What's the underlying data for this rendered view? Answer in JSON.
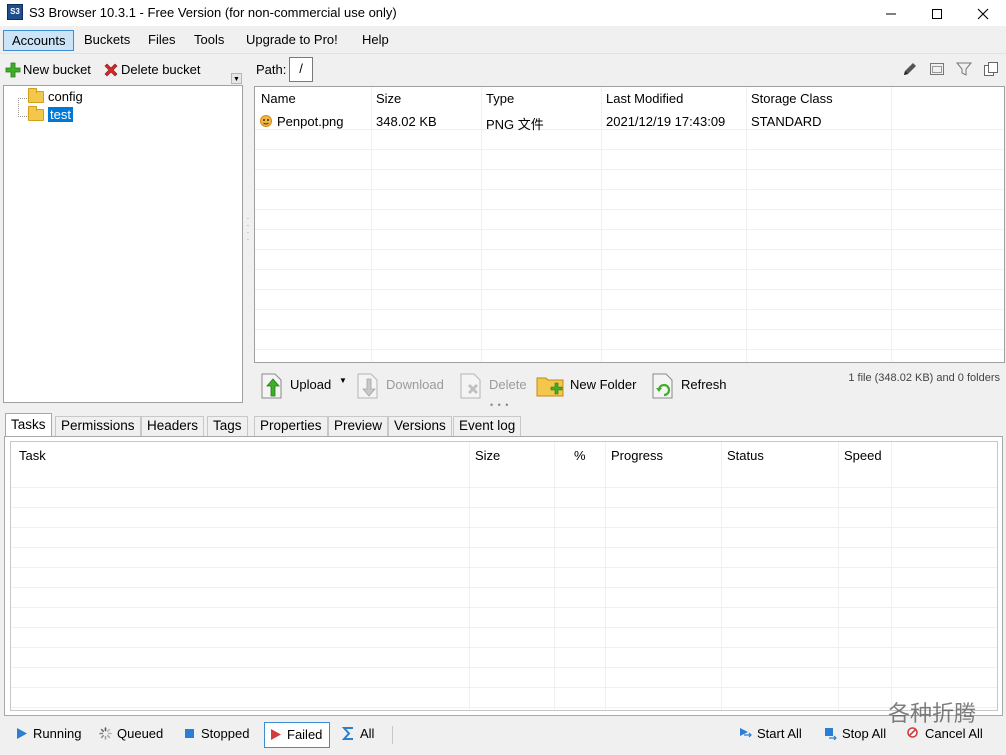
{
  "window": {
    "title": "S3 Browser 10.3.1 - Free Version (for non-commercial use only)",
    "icon_label": "S3"
  },
  "menu": [
    "Accounts",
    "Buckets",
    "Files",
    "Tools",
    "Upgrade to Pro!",
    "Help"
  ],
  "left_toolbar": {
    "new_bucket": "New bucket",
    "delete_bucket": "Delete bucket"
  },
  "tree": {
    "items": [
      "config",
      "test"
    ],
    "selected": "test"
  },
  "path": {
    "label": "Path:",
    "value": "/"
  },
  "file_table": {
    "columns": [
      "Name",
      "Size",
      "Type",
      "Last Modified",
      "Storage Class"
    ],
    "rows": [
      [
        "Penpot.png",
        "348.02 KB",
        "PNG 文件",
        "2021/12/19 17:43:09",
        "STANDARD"
      ]
    ]
  },
  "file_toolbar": {
    "upload": "Upload",
    "download": "Download",
    "delete": "Delete",
    "new_folder": "New Folder",
    "refresh": "Refresh",
    "status": "1 file (348.02 KB) and 0 folders"
  },
  "tabs": [
    "Tasks",
    "Permissions",
    "Headers",
    "Tags",
    "Properties",
    "Preview",
    "Versions",
    "Event log"
  ],
  "active_tab": "Tasks",
  "task_table": {
    "columns": [
      "Task",
      "Size",
      "%",
      "Progress",
      "Status",
      "Speed"
    ]
  },
  "status_filters": {
    "running": "Running",
    "queued": "Queued",
    "stopped": "Stopped",
    "failed": "Failed",
    "all": "All",
    "active": "Failed"
  },
  "status_actions": {
    "start_all": "Start All",
    "stop_all": "Stop All",
    "cancel_all": "Cancel All"
  },
  "watermark": "各种折腾",
  "colors": {
    "selection": "#0078d7",
    "menu_highlight": "#cce4f7",
    "folder": "#f3c64c",
    "running": "#2a7fd4",
    "failed": "#d23c3c",
    "add_green": "#3fae2a",
    "delete_red": "#d22b2b"
  }
}
